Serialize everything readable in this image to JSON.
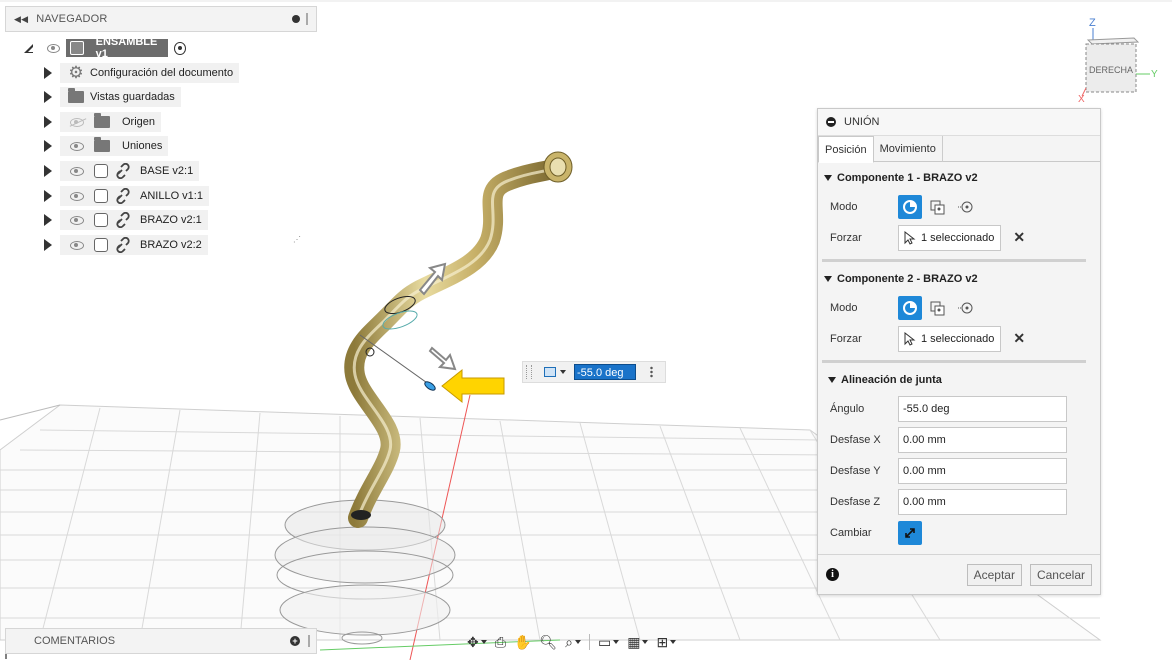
{
  "navigator": {
    "title": "NAVEGADOR",
    "assembly": {
      "label": "ENSAMBLE v1"
    },
    "items": [
      {
        "label": "Configuración del documento",
        "icon": "gear-icon",
        "visible": true
      },
      {
        "label": "Vistas guardadas",
        "icon": "folder-icon",
        "visible": true
      },
      {
        "label": "Origen",
        "icon": "folder-icon",
        "visible": false
      },
      {
        "label": "Uniones",
        "icon": "folder-icon",
        "visible": true
      },
      {
        "label": "BASE v2:1",
        "icon": "component-icon",
        "visible": true
      },
      {
        "label": "ANILLO v1:1",
        "icon": "component-icon",
        "visible": true
      },
      {
        "label": "BRAZO v2:1",
        "icon": "component-icon",
        "visible": true
      },
      {
        "label": "BRAZO v2:2",
        "icon": "component-icon",
        "visible": true
      }
    ]
  },
  "viewcube": {
    "face": "DERECHA",
    "axis_z": "Z",
    "axis_y": "Y",
    "axis_x": "X"
  },
  "angle_input": {
    "value": "-55.0 deg"
  },
  "dialog": {
    "title": "UNIÓN",
    "tabs": [
      "Posición",
      "Movimiento"
    ],
    "component1": {
      "heading": "Componente 1 - BRAZO v2",
      "mode_label": "Modo",
      "force_label": "Forzar",
      "selection": "1 seleccionado"
    },
    "component2": {
      "heading": "Componente 2 - BRAZO v2",
      "mode_label": "Modo",
      "force_label": "Forzar",
      "selection": "1 seleccionado"
    },
    "alignment": {
      "heading": "Alineación de junta",
      "angle_label": "Ángulo",
      "angle_value": "-55.0 deg",
      "offset_x_label": "Desfase X",
      "offset_x_value": "0.00 mm",
      "offset_y_label": "Desfase Y",
      "offset_y_value": "0.00 mm",
      "offset_z_label": "Desfase Z",
      "offset_z_value": "0.00 mm",
      "swap_label": "Cambiar"
    },
    "ok_label": "Aceptar",
    "cancel_label": "Cancelar"
  },
  "comments": {
    "title": "COMENTARIOS"
  },
  "colors": {
    "accent": "#1e88d8",
    "model_gold": "#c9b46a",
    "highlight_arrow": "#ffd400",
    "grid_line": "#d7d7d7"
  }
}
